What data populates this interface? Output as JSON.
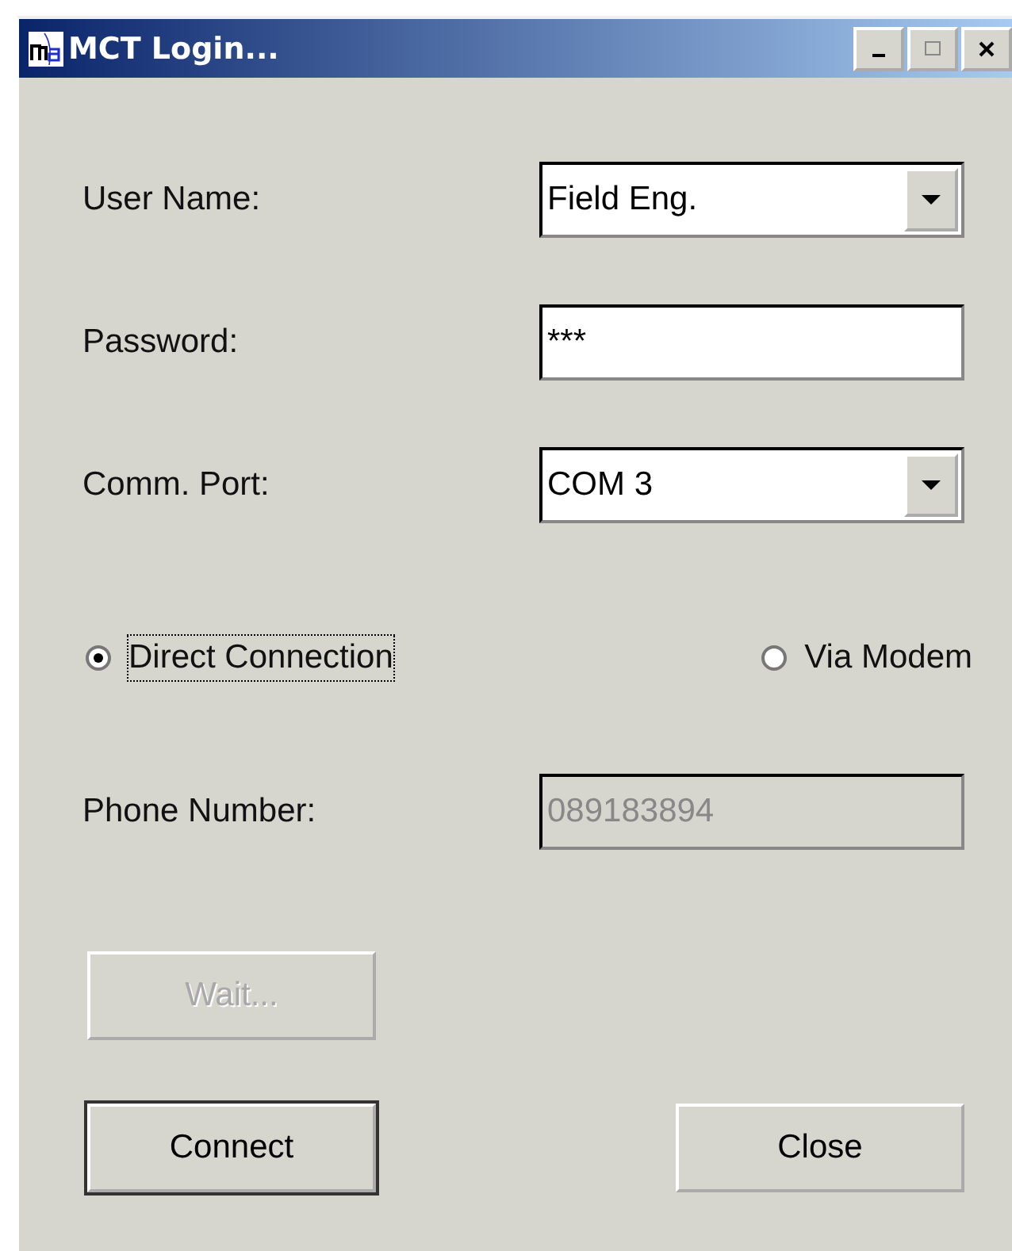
{
  "window": {
    "title": "MCT Login...",
    "controls": [
      {
        "kind": "minimize"
      },
      {
        "kind": "maximize"
      },
      {
        "kind": "close"
      }
    ]
  },
  "fields": [
    {
      "label": "User Name:",
      "kind": "dropdown",
      "value": "Field Eng."
    },
    {
      "label": "Password:",
      "kind": "text",
      "value": "***"
    },
    {
      "label": "Comm. Port:",
      "kind": "dropdown",
      "value": "COM 3"
    }
  ],
  "connection": [
    {
      "label": "Direct Connection",
      "selected": true,
      "focused": true
    },
    {
      "label": "Via Modem",
      "selected": false,
      "focused": false
    }
  ],
  "phone": {
    "label": "Phone Number:",
    "value": "089183894",
    "disabled": true
  },
  "wait_button": {
    "label": "Wait...",
    "disabled": true
  },
  "buttons": [
    {
      "label": "Connect",
      "default": true
    },
    {
      "label": "Close",
      "default": false
    }
  ]
}
